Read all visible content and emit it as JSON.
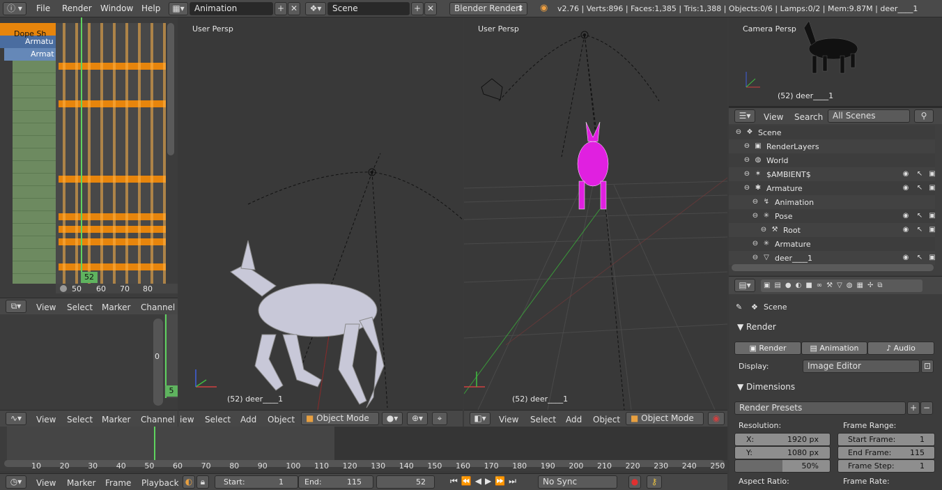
{
  "topbar": {
    "menus": [
      "File",
      "Render",
      "Window",
      "Help"
    ],
    "layout": "Animation",
    "scene": "Scene",
    "engine": "Blender Render",
    "stats": "v2.76 | Verts:896 | Faces:1,385 | Tris:1,388 | Objects:0/6 | Lamps:0/2 | Mem:9.87M | deer____1"
  },
  "dopesheet": {
    "rows": [
      "Dope Sh",
      "Armatu",
      "Armat"
    ],
    "frame_labels": [
      "50",
      "60",
      "70",
      "80"
    ],
    "current_frame": "52",
    "menus": [
      "View",
      "Select",
      "Marker",
      "Channel"
    ]
  },
  "graph": {
    "label": "0",
    "current": "5",
    "menus": [
      "View",
      "Select",
      "Marker",
      "Channel"
    ]
  },
  "viewport_left": {
    "label": "User Persp",
    "object": "(52) deer____1",
    "menus": [
      "iew",
      "Select",
      "Add",
      "Object"
    ],
    "mode": "Object Mode"
  },
  "viewport_right": {
    "label": "User Persp",
    "object": "(52) deer____1",
    "menus": [
      "View",
      "Select",
      "Add",
      "Object"
    ],
    "mode": "Object Mode"
  },
  "camera_view": {
    "label": "Camera Persp",
    "object": "(52) deer____1"
  },
  "outliner": {
    "menus": [
      "View",
      "Search"
    ],
    "filter": "All Scenes",
    "items": [
      {
        "label": "Scene",
        "indent": 0
      },
      {
        "label": "RenderLayers",
        "indent": 1
      },
      {
        "label": "World",
        "indent": 1
      },
      {
        "label": "$AMBIENT$",
        "indent": 1
      },
      {
        "label": "Armature",
        "indent": 1
      },
      {
        "label": "Animation",
        "indent": 2
      },
      {
        "label": "Pose",
        "indent": 2
      },
      {
        "label": "Root",
        "indent": 3
      },
      {
        "label": "Armature",
        "indent": 2
      },
      {
        "label": "deer____1",
        "indent": 2
      }
    ]
  },
  "properties": {
    "scene": "Scene",
    "render_section": "Render",
    "buttons": [
      "Render",
      "Animation",
      "Audio"
    ],
    "display_label": "Display:",
    "display_value": "Image Editor",
    "dimensions_section": "Dimensions",
    "presets": "Render Presets",
    "resolution_label": "Resolution:",
    "x_label": "X:",
    "x_value": "1920 px",
    "y_label": "Y:",
    "y_value": "1080 px",
    "percent": "50%",
    "frame_range_label": "Frame Range:",
    "start_label": "Start Frame:",
    "start_value": "1",
    "end_label": "End Frame:",
    "end_value": "115",
    "step_label": "Frame Step:",
    "step_value": "1",
    "aspect_label": "Aspect Ratio:",
    "frame_rate_label": "Frame Rate:"
  },
  "timeline": {
    "ticks": [
      "10",
      "20",
      "30",
      "40",
      "50",
      "60",
      "70",
      "80",
      "90",
      "100",
      "110",
      "120",
      "130",
      "140",
      "150",
      "160",
      "170",
      "180",
      "190",
      "200",
      "210",
      "220",
      "230",
      "240",
      "250"
    ],
    "menus": [
      "View",
      "Marker",
      "Frame",
      "Playback"
    ],
    "start_label": "Start:",
    "start_value": "1",
    "end_label": "End:",
    "end_value": "115",
    "current": "52",
    "sync": "No Sync"
  }
}
